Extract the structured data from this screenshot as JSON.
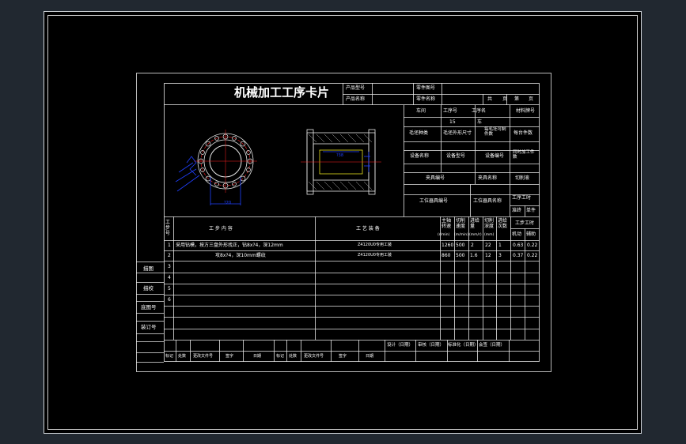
{
  "card": {
    "title": "机械加工工序卡片",
    "product_model_label": "产品型号",
    "product_name_label": "产品名称",
    "part_drawing_label": "零件图号",
    "part_name_label": "零件名称",
    "total_label": "共",
    "page_unit": "页",
    "sheet_label": "第",
    "page_unit_2": "页"
  },
  "info": {
    "workshop_label": "车间",
    "process_no_label": "工序号",
    "process_name_label": "工序名",
    "material_label": "材料牌号",
    "process_no_value": "15",
    "process_name_value": "车",
    "blank_type_label": "毛坯种类",
    "blank_size_label": "毛坯外形尺寸",
    "blank_count_label": "每毛坯可制件数",
    "parts_per_unit_label": "每台件数",
    "equipment_name_label": "设备名称",
    "equipment_model_label": "设备型号",
    "equipment_no_label": "设备编号",
    "simultaneous_label": "同时加工件数",
    "fixture_no_label": "夹具编号",
    "fixture_name_label": "夹具名称",
    "coolant_label": "切削液",
    "station_tool_no_label": "工位器具编号",
    "station_tool_name_label": "工位器具名称",
    "process_hours_label": "工序工时",
    "prep_time_label": "准终",
    "unit_time_label": "单件"
  },
  "table_header": {
    "step_no": "工步号",
    "step_content": "工 步 内 容",
    "equipment": "工 艺 装 备",
    "spindle_speed": "主轴转速",
    "spindle_unit": "(r/min)",
    "cutting_speed": "切削速度",
    "cutting_speed_unit": "(m/min)",
    "feed": "进给量",
    "feed_unit": "(mm/r)",
    "depth": "切削深度",
    "depth_unit": "(mm)",
    "passes": "进给次数",
    "step_hours": "工步工时",
    "machine_time": "机动",
    "aux_time": "辅助"
  },
  "rows": [
    {
      "no": "1",
      "content": "采用钻模，按方三盘外形找正，钻8x?4，深12mm",
      "equipment": "Z4120U0专用工装",
      "speed": "1260",
      "vc": "500",
      "feed": "2",
      "depth": "22",
      "passes": "1",
      "machine": "0.63",
      "aux": "0.22"
    },
    {
      "no": "2",
      "content": "攻8x?4，深10mm螺纹",
      "equipment": "Z4120U0专用工装",
      "speed": "860",
      "vc": "500",
      "feed": "1.6",
      "depth": "12",
      "passes": "3",
      "machine": "0.37",
      "aux": "0.22"
    },
    {
      "no": "3"
    },
    {
      "no": "4"
    },
    {
      "no": "5"
    },
    {
      "no": "6"
    }
  ],
  "side_labels": {
    "trace": "描图",
    "proofread": "描校",
    "base_drawing": "底图号",
    "binding": "装订号"
  },
  "sign_row": {
    "design": "设计（日期）",
    "review": "审核（日期）",
    "standard": "标准化（日期）",
    "countersign": "会签（日期）"
  },
  "bottom_row": [
    "标记",
    "处数",
    "更改文件号",
    "签字",
    "日期",
    "标记",
    "处数",
    "更改文件号",
    "签字",
    "日期"
  ],
  "drawing": {
    "dim_left": "?20",
    "dim_mid": "?38"
  },
  "colors": {
    "background": "#212830",
    "sheet": "#000000",
    "line": "#e8e8e8",
    "red": "#ff2020",
    "blue": "#2040ff",
    "yellow": "#e8e020"
  }
}
